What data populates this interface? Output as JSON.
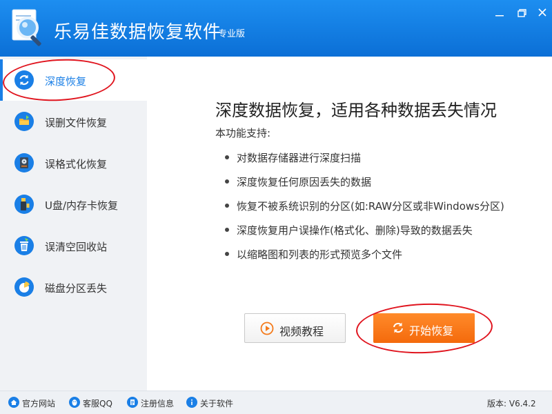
{
  "titlebar": {
    "title": "乐易佳数据恢复软件",
    "edition": "专业版",
    "brand_color": "#1a7fe6"
  },
  "sidebar": {
    "items": [
      {
        "label": "深度恢复",
        "icon": "refresh-icon",
        "active": true
      },
      {
        "label": "误删文件恢复",
        "icon": "folder-icon",
        "active": false
      },
      {
        "label": "误格式化恢复",
        "icon": "hard-disk-icon",
        "active": false
      },
      {
        "label": "U盘/内存卡恢复",
        "icon": "usb-drive-icon",
        "active": false
      },
      {
        "label": "误清空回收站",
        "icon": "recycle-bin-icon",
        "active": false
      },
      {
        "label": "磁盘分区丢失",
        "icon": "pie-chart-icon",
        "active": false
      }
    ]
  },
  "main": {
    "title": "深度数据恢复，适用各种数据丢失情况",
    "support_label": "本功能支持:",
    "features": [
      "对数据存储器进行深度扫描",
      "深度恢复任何原因丢失的数据",
      "恢复不被系统识别的分区(如:RAW分区或非Windows分区)",
      "深度恢复用户误操作(格式化、删除)导致的数据丢失",
      "以缩略图和列表的形式预览多个文件"
    ],
    "video_button": "视频教程",
    "start_button": "开始恢复",
    "start_color": "#f47a1a"
  },
  "statusbar": {
    "links": [
      {
        "label": "官方网站",
        "icon": "home-icon"
      },
      {
        "label": "客服QQ",
        "icon": "qq-icon"
      },
      {
        "label": "注册信息",
        "icon": "register-icon"
      },
      {
        "label": "关于软件",
        "icon": "info-icon"
      }
    ],
    "version": "版本: V6.4.2"
  },
  "annotations": {
    "color": "#e0141e"
  }
}
